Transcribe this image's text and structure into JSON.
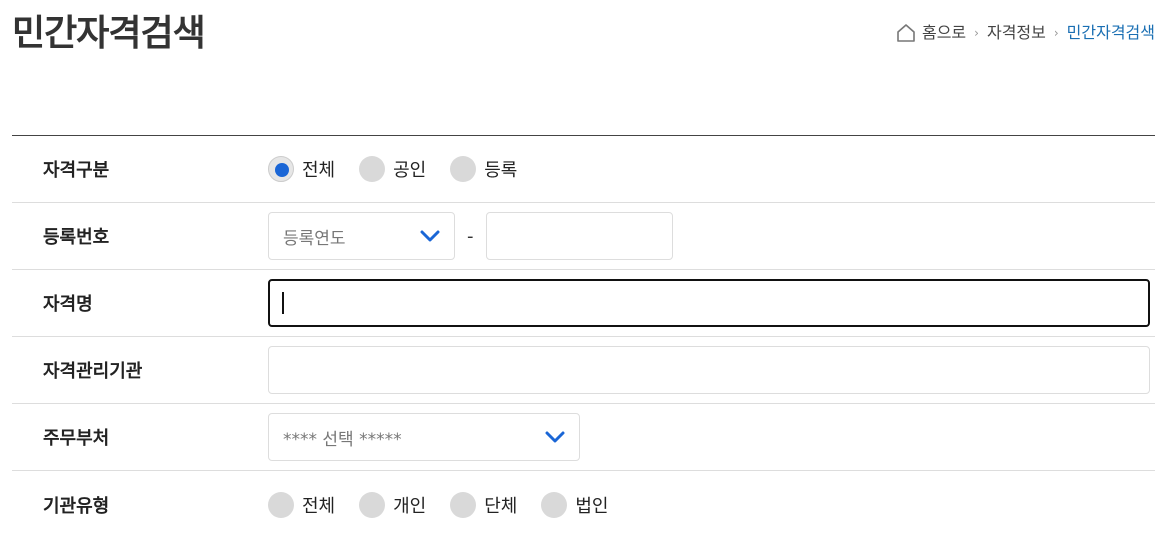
{
  "header": {
    "title": "민간자격검색",
    "breadcrumb": {
      "home": "홈으로",
      "level1": "자격정보",
      "current": "민간자격검색"
    }
  },
  "form": {
    "qualification_type": {
      "label": "자격구분",
      "options": [
        "전체",
        "공인",
        "등록"
      ],
      "selected": "전체"
    },
    "registration_number": {
      "label": "등록번호",
      "year_placeholder": "등록연도",
      "separator": "-",
      "number_value": ""
    },
    "qualification_name": {
      "label": "자격명",
      "value": ""
    },
    "managing_agency": {
      "label": "자격관리기관",
      "value": ""
    },
    "ministry": {
      "label": "주무부처",
      "placeholder": "**** 선택 *****"
    },
    "agency_type": {
      "label": "기관유형",
      "options": [
        "전체",
        "개인",
        "단체",
        "법인"
      ],
      "selected": ""
    }
  },
  "colors": {
    "accent": "#1a66d6",
    "breadcrumb_current": "#1a6fb3",
    "chevron": "#1a66d6"
  }
}
